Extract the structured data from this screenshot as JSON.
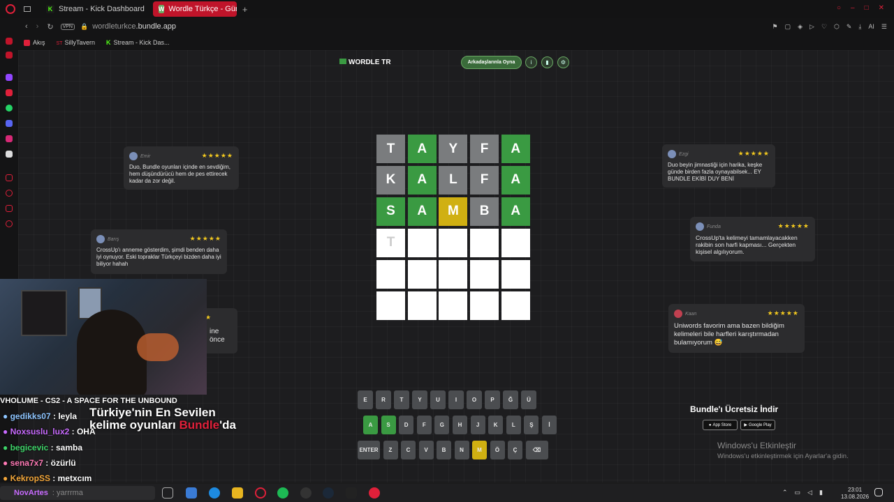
{
  "tabs": [
    {
      "label": "Stream - Kick Dashboard",
      "fav": "K",
      "color": "#53fc18"
    },
    {
      "label": "Wordle Türkçe - Günlük Ke",
      "fav": "W",
      "color": "#6aaa64"
    }
  ],
  "url": {
    "domain": "wordleturkce",
    "rest": ".bundle.app",
    "vpn": "VPN"
  },
  "bookmarks": [
    "Akış",
    "SillyTavern",
    "Stream - Kick Das..."
  ],
  "header": {
    "logo": "WORDLE TR",
    "play_button": "Arkadaşlarınla Oyna"
  },
  "board": [
    [
      [
        "T",
        "x"
      ],
      [
        "A",
        "g"
      ],
      [
        "Y",
        "x"
      ],
      [
        "F",
        "x"
      ],
      [
        "A",
        "g"
      ]
    ],
    [
      [
        "K",
        "x"
      ],
      [
        "A",
        "g"
      ],
      [
        "L",
        "x"
      ],
      [
        "F",
        "x"
      ],
      [
        "A",
        "g"
      ]
    ],
    [
      [
        "S",
        "g"
      ],
      [
        "A",
        "g"
      ],
      [
        "M",
        "y"
      ],
      [
        "B",
        "x"
      ],
      [
        "A",
        "g"
      ]
    ],
    [
      [
        "T",
        "e"
      ],
      [
        "",
        "e"
      ],
      [
        "",
        "e"
      ],
      [
        "",
        "e"
      ],
      [
        "",
        "e"
      ]
    ],
    [
      [
        "",
        "e"
      ],
      [
        "",
        "e"
      ],
      [
        "",
        "e"
      ],
      [
        "",
        "e"
      ],
      [
        "",
        "e"
      ]
    ],
    [
      [
        "",
        "e"
      ],
      [
        "",
        "e"
      ],
      [
        "",
        "e"
      ],
      [
        "",
        "e"
      ],
      [
        "",
        "e"
      ]
    ]
  ],
  "keyboard": [
    [
      [
        "E",
        ""
      ],
      [
        "R",
        ""
      ],
      [
        "T",
        ""
      ],
      [
        "Y",
        ""
      ],
      [
        "U",
        ""
      ],
      [
        "I",
        ""
      ],
      [
        "O",
        ""
      ],
      [
        "P",
        ""
      ],
      [
        "Ğ",
        ""
      ],
      [
        "Ü",
        ""
      ]
    ],
    [
      [
        "A",
        "g"
      ],
      [
        "S",
        "g"
      ],
      [
        "D",
        ""
      ],
      [
        "F",
        ""
      ],
      [
        "G",
        ""
      ],
      [
        "H",
        ""
      ],
      [
        "J",
        ""
      ],
      [
        "K",
        ""
      ],
      [
        "L",
        ""
      ],
      [
        "Ş",
        ""
      ],
      [
        "İ",
        ""
      ]
    ],
    [
      [
        "ENTER",
        ""
      ],
      [
        "Z",
        ""
      ],
      [
        "C",
        ""
      ],
      [
        "V",
        ""
      ],
      [
        "B",
        ""
      ],
      [
        "N",
        ""
      ],
      [
        "M",
        "y"
      ],
      [
        "Ö",
        ""
      ],
      [
        "Ç",
        ""
      ],
      [
        "⌫",
        ""
      ]
    ]
  ],
  "reviews": [
    {
      "name": "Emir",
      "text": "Duo, Bundle oyunları içinde en sevdiğim, hem düşündürücü hem de pes ettirecek kadar da zor değil."
    },
    {
      "name": "Barış",
      "text": "CrossUp'ı anneme gösterdim, şimdi benden daha iyi oynuyor. Eski topraklar Türkçeyi bizden daha iyi biliyor hahah"
    },
    {
      "name": "Ezgi",
      "text": "Duo beyin jimnastiği için harika, keşke günde birden fazla oynayabilsek... EY BUNDLE EKİBİ DUY BENİ"
    },
    {
      "name": "Funda",
      "text": "CrossUp'ta kelimeyi tamamlayacakken rakibin son harfi kapması... Gerçekten kişisel algılıyorum."
    },
    {
      "name": "Kaan",
      "text": "Uniwords favorim ama bazen bildiğim kelimeleri bile harfleri karıştırmadan bulamıyorum 😅"
    }
  ],
  "partial_review": {
    "line1": "ine",
    "line2": "önce"
  },
  "download": {
    "title": "Bundle'ı Ücretsiz İndir",
    "appstore": "App Store",
    "googleplay": "Google Play"
  },
  "windows": {
    "title": "Windows'u Etkinleştir",
    "sub": "Windows'u etkinleştirmek için Ayarlar'a gidin."
  },
  "overlay": {
    "title": "VHOLUME - CS2 - A SPACE FOR THE UNBOUND",
    "promo1": "Türkiye'nin En Sevilen",
    "promo2a": "kelime oyunları ",
    "promo2b": "Bundle",
    "promo2c": "'da"
  },
  "chat": [
    {
      "user": "gedikks07",
      "msg": "leyla",
      "color": "#8ec5ff"
    },
    {
      "user": "Noxsuslu_lux2",
      "msg": "OHA",
      "color": "#c86bff"
    },
    {
      "user": "begicevic",
      "msg": "samba",
      "color": "#3fd66a"
    },
    {
      "user": "sena7x7",
      "msg": "özürlü",
      "color": "#ff7ab6"
    },
    {
      "user": "KekropSS",
      "msg": "metxcım",
      "color": "#f2a63a"
    }
  ],
  "search_placeholder": "yarrrma",
  "search_user": "NovArtes",
  "clock": {
    "time": "23:01",
    "date": "13.08.2026"
  }
}
